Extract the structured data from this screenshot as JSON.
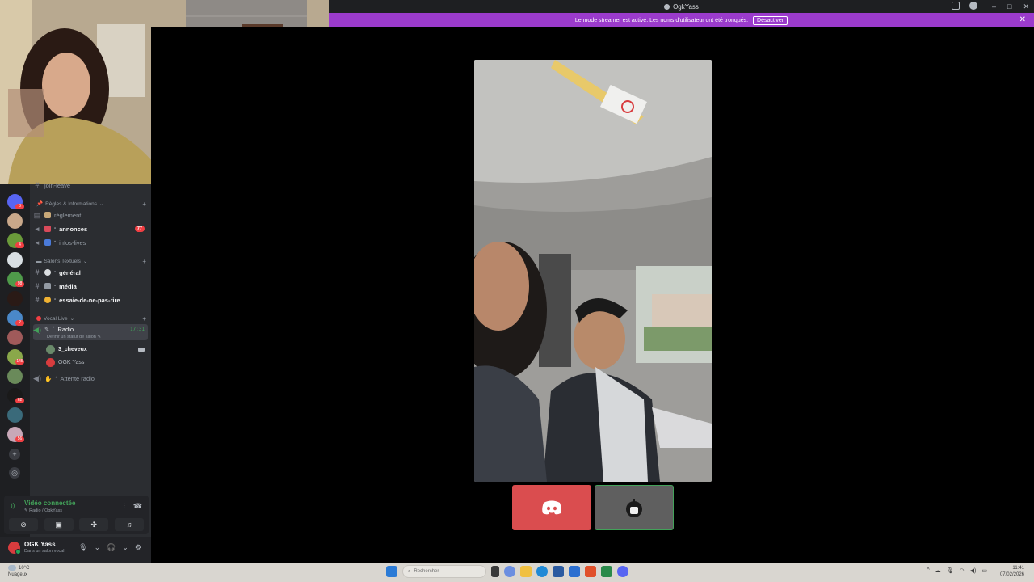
{
  "window": {
    "title": "OgkYass",
    "controls": {
      "minimize": "–",
      "maximize": "□",
      "close": "✕"
    }
  },
  "banner": {
    "message": "Le mode streamer est activé. Les noms d'utilisateur ont été tronqués.",
    "button": "Désactiver",
    "close": "✕"
  },
  "server_rail": {
    "badges": [
      "3",
      "",
      "4",
      "",
      "98",
      "",
      "2",
      "",
      "145",
      "",
      "62",
      "",
      "56"
    ]
  },
  "channels": {
    "top_partial": "join-leave",
    "categories": [
      {
        "label": "Règles & Informations",
        "items": [
          {
            "name": "règlement",
            "unread": false,
            "badge": ""
          },
          {
            "name": "annonces",
            "unread": true,
            "badge": "77"
          },
          {
            "name": "infos-lives",
            "unread": false,
            "badge": ""
          }
        ]
      },
      {
        "label": "Salons Textuels",
        "items": [
          {
            "name": "général",
            "unread": true,
            "badge": ""
          },
          {
            "name": "média",
            "unread": true,
            "badge": ""
          },
          {
            "name": "essaie-de-ne-pas-rire",
            "unread": true,
            "badge": ""
          }
        ]
      },
      {
        "label": "Vocal Live",
        "items": [
          {
            "name": "Radio",
            "time": "17:31",
            "status": "Définir un statut de salon"
          },
          {
            "name": "Attente radio"
          }
        ]
      }
    ],
    "voice_users": [
      "3_cheveux",
      "OGK Yass"
    ]
  },
  "voice_panel": {
    "title": "Vidéo connectée",
    "subtitle": "Radio / OgkYass"
  },
  "user_panel": {
    "name": "OGK Yass",
    "status": "Dans un salon vocal"
  },
  "taskbar": {
    "weather_temp": "10°C",
    "weather_desc": "Nuageux",
    "search_placeholder": "Rechercher",
    "time": "11:41",
    "date": "07/02/2026"
  },
  "colors": {
    "banner": "#9b3bcc",
    "voice_green": "#43a25a",
    "badge_red": "#f23f43",
    "discord_tile": "#da4d4f"
  }
}
